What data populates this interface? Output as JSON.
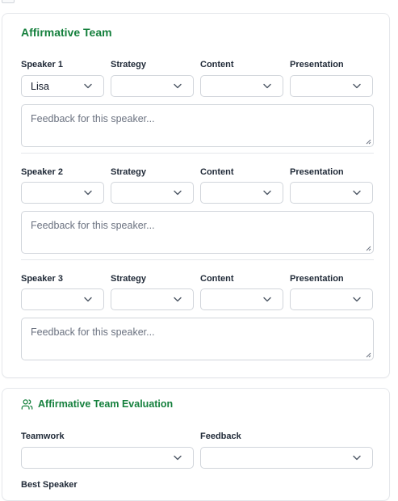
{
  "affirmative_team": {
    "title": "Affirmative Team",
    "speakers": [
      {
        "label": "Speaker 1",
        "name": "Lisa",
        "strategy": "",
        "content": "",
        "presentation": "",
        "feedback_placeholder": "Feedback for this speaker..."
      },
      {
        "label": "Speaker 2",
        "name": "",
        "strategy": "",
        "content": "",
        "presentation": "",
        "feedback_placeholder": "Feedback for this speaker..."
      },
      {
        "label": "Speaker 3",
        "name": "",
        "strategy": "",
        "content": "",
        "presentation": "",
        "feedback_placeholder": "Feedback for this speaker..."
      }
    ],
    "columns": {
      "strategy": "Strategy",
      "content": "Content",
      "presentation": "Presentation"
    }
  },
  "team_evaluation": {
    "title": "Affirmative Team Evaluation",
    "icon": "users-icon",
    "teamwork_label": "Teamwork",
    "teamwork_value": "",
    "feedback_label": "Feedback",
    "feedback_value": "",
    "best_speaker_label": "Best Speaker"
  },
  "colors": {
    "accent_green": "#15803d",
    "border": "#d1d5db",
    "placeholder": "#6b7280"
  }
}
